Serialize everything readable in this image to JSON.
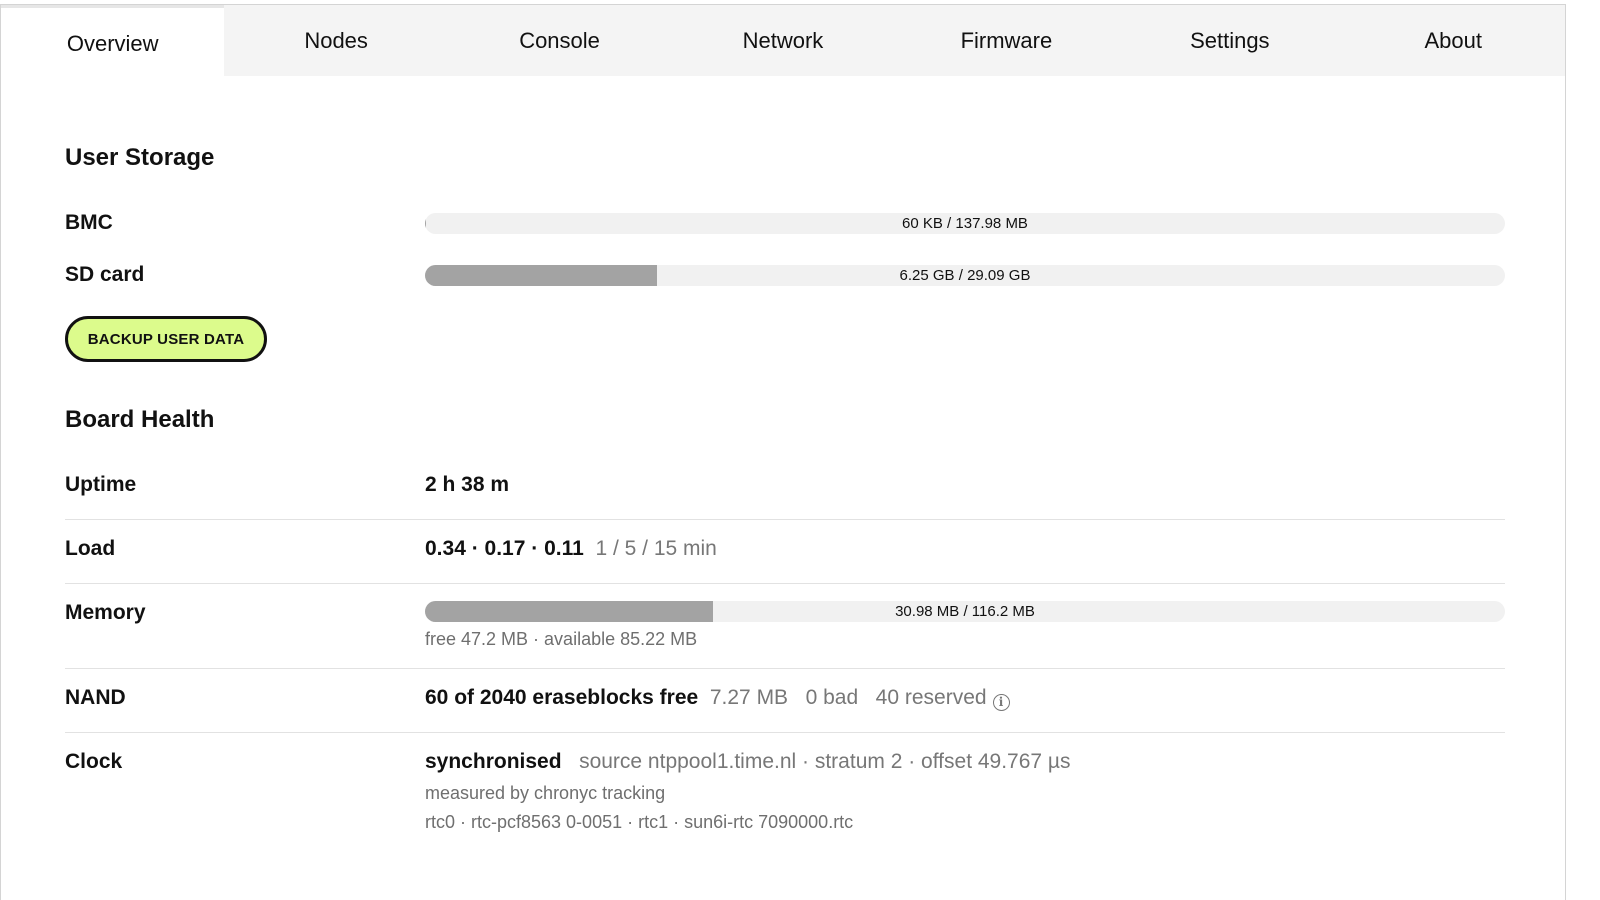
{
  "tabs": [
    {
      "label": "Overview",
      "active": true
    },
    {
      "label": "Nodes",
      "active": false
    },
    {
      "label": "Console",
      "active": false
    },
    {
      "label": "Network",
      "active": false
    },
    {
      "label": "Firmware",
      "active": false
    },
    {
      "label": "Settings",
      "active": false
    },
    {
      "label": "About",
      "active": false
    }
  ],
  "storage": {
    "title": "User Storage",
    "bmc": {
      "label": "BMC",
      "text": "60 KB / 137.98 MB",
      "used_fraction": 0.0004
    },
    "sd": {
      "label": "SD card",
      "text": "6.25 GB / 29.09 GB",
      "used_fraction": 0.215
    },
    "backup_button": "BACKUP USER DATA"
  },
  "health": {
    "title": "Board Health",
    "uptime": {
      "label": "Uptime",
      "value": "2 h 38 m"
    },
    "load": {
      "label": "Load",
      "value": "0.34 · 0.17 · 0.11",
      "detail": "1 / 5 / 15 min"
    },
    "memory": {
      "label": "Memory",
      "text": "30.98 MB / 116.2 MB",
      "used_fraction": 0.2666,
      "detail": "free 47.2 MB · available 85.22 MB"
    },
    "nand": {
      "label": "NAND",
      "value": "60 of 2040 eraseblocks free",
      "size": "7.27 MB",
      "bad": "0 bad",
      "reserved": "40 reserved",
      "icon": "info-icon"
    },
    "clock": {
      "label": "Clock",
      "status": "synchronised",
      "detail": "source ntppool1.time.nl · stratum 2 · offset 49.767 µs",
      "measured": "measured by chronyc tracking",
      "rtc": "rtc0 · rtc-pcf8563 0-0051 · rtc1 · sun6i-rtc 7090000.rtc"
    }
  },
  "colors": {
    "accent_button": "#dcfb8c",
    "bar_fill": "#a3a3a3",
    "bar_track": "#f1f1f1",
    "tab_bar": "#f4f4f4"
  }
}
